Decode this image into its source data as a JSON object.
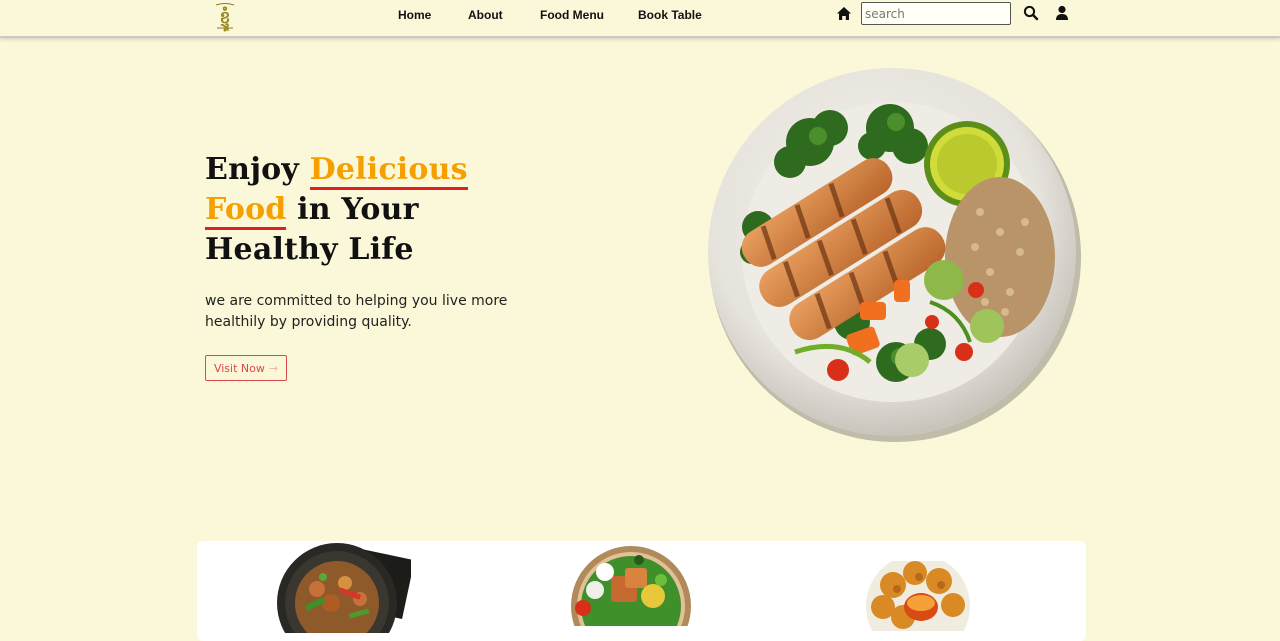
{
  "nav": {
    "logo_icon": "khmer-text-logo-icon",
    "links": [
      {
        "label": "Home"
      },
      {
        "label": "About"
      },
      {
        "label": "Food Menu"
      },
      {
        "label": "Book Table"
      }
    ],
    "search_placeholder": "search",
    "icons": [
      "home-icon",
      "search-icon",
      "user-icon"
    ]
  },
  "hero": {
    "title_part1": "Enjoy ",
    "title_highlight1": "Delicious",
    "title_highlight2": "Food",
    "title_part2": " in Your",
    "title_part3": "Healthy Life",
    "description": "we are committed to helping you live more healthily by providing quality.",
    "button_label": "Visit Now",
    "button_arrow": "→"
  },
  "colors": {
    "background": "#fbf8d9",
    "highlight": "#f5a000",
    "underline": "#e02020",
    "button": "#d94a4a"
  },
  "dishes": [
    {
      "icon": "stir-fry-dish-icon"
    },
    {
      "icon": "salad-bowl-icon"
    },
    {
      "icon": "fried-nuggets-icon"
    }
  ]
}
